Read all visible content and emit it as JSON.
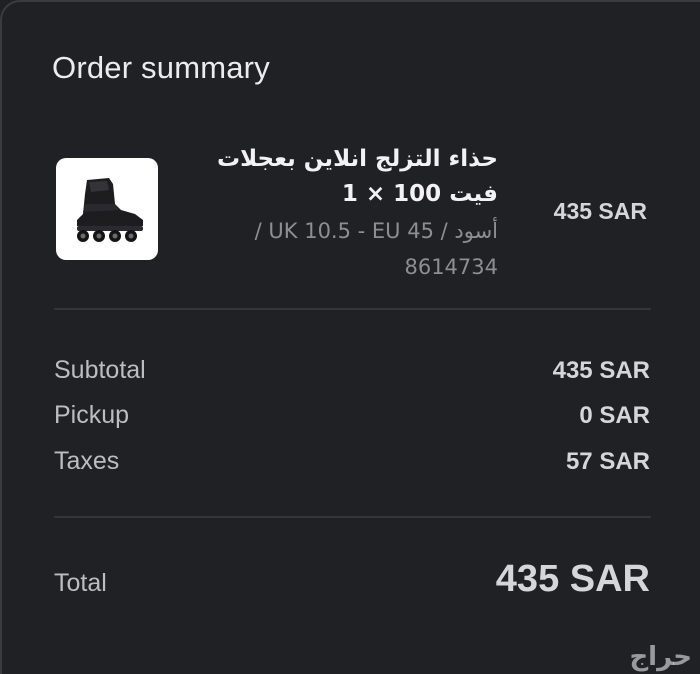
{
  "summary": {
    "title": "Order summary"
  },
  "item": {
    "image_icon": "inline-skate-image",
    "name": "حذاء التزلج انلاين بعجلات",
    "qty_line": "فيت 100 × 1",
    "variant_line1": "أسود / UK 10.5 - EU 45 /",
    "variant_line2": "8614734",
    "price": "435 SAR"
  },
  "costs": {
    "subtotal_label": "Subtotal",
    "subtotal_value": "435 SAR",
    "pickup_label": "Pickup",
    "pickup_value": "0 SAR",
    "taxes_label": "Taxes",
    "taxes_value": "57 SAR"
  },
  "total": {
    "label": "Total",
    "value": "435 SAR"
  },
  "watermark": "حراج",
  "colors": {
    "background": "#202125",
    "text_primary": "#ececee",
    "text_secondary": "#8d8e93",
    "divider": "#35363b"
  }
}
